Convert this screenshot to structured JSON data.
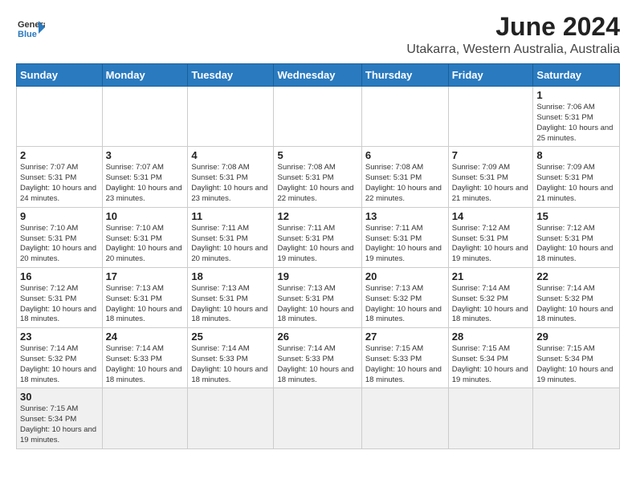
{
  "logo": {
    "text_general": "General",
    "text_blue": "Blue"
  },
  "title": "June 2024",
  "subtitle": "Utakarra, Western Australia, Australia",
  "days_of_week": [
    "Sunday",
    "Monday",
    "Tuesday",
    "Wednesday",
    "Thursday",
    "Friday",
    "Saturday"
  ],
  "weeks": [
    [
      {
        "day": "",
        "info": ""
      },
      {
        "day": "",
        "info": ""
      },
      {
        "day": "",
        "info": ""
      },
      {
        "day": "",
        "info": ""
      },
      {
        "day": "",
        "info": ""
      },
      {
        "day": "",
        "info": ""
      },
      {
        "day": "1",
        "info": "Sunrise: 7:06 AM\nSunset: 5:31 PM\nDaylight: 10 hours\nand 25 minutes."
      }
    ],
    [
      {
        "day": "2",
        "info": "Sunrise: 7:07 AM\nSunset: 5:31 PM\nDaylight: 10 hours\nand 24 minutes."
      },
      {
        "day": "3",
        "info": "Sunrise: 7:07 AM\nSunset: 5:31 PM\nDaylight: 10 hours\nand 23 minutes."
      },
      {
        "day": "4",
        "info": "Sunrise: 7:08 AM\nSunset: 5:31 PM\nDaylight: 10 hours\nand 23 minutes."
      },
      {
        "day": "5",
        "info": "Sunrise: 7:08 AM\nSunset: 5:31 PM\nDaylight: 10 hours\nand 22 minutes."
      },
      {
        "day": "6",
        "info": "Sunrise: 7:08 AM\nSunset: 5:31 PM\nDaylight: 10 hours\nand 22 minutes."
      },
      {
        "day": "7",
        "info": "Sunrise: 7:09 AM\nSunset: 5:31 PM\nDaylight: 10 hours\nand 21 minutes."
      },
      {
        "day": "8",
        "info": "Sunrise: 7:09 AM\nSunset: 5:31 PM\nDaylight: 10 hours\nand 21 minutes."
      }
    ],
    [
      {
        "day": "9",
        "info": "Sunrise: 7:10 AM\nSunset: 5:31 PM\nDaylight: 10 hours\nand 20 minutes."
      },
      {
        "day": "10",
        "info": "Sunrise: 7:10 AM\nSunset: 5:31 PM\nDaylight: 10 hours\nand 20 minutes."
      },
      {
        "day": "11",
        "info": "Sunrise: 7:11 AM\nSunset: 5:31 PM\nDaylight: 10 hours\nand 20 minutes."
      },
      {
        "day": "12",
        "info": "Sunrise: 7:11 AM\nSunset: 5:31 PM\nDaylight: 10 hours\nand 19 minutes."
      },
      {
        "day": "13",
        "info": "Sunrise: 7:11 AM\nSunset: 5:31 PM\nDaylight: 10 hours\nand 19 minutes."
      },
      {
        "day": "14",
        "info": "Sunrise: 7:12 AM\nSunset: 5:31 PM\nDaylight: 10 hours\nand 19 minutes."
      },
      {
        "day": "15",
        "info": "Sunrise: 7:12 AM\nSunset: 5:31 PM\nDaylight: 10 hours\nand 18 minutes."
      }
    ],
    [
      {
        "day": "16",
        "info": "Sunrise: 7:12 AM\nSunset: 5:31 PM\nDaylight: 10 hours\nand 18 minutes."
      },
      {
        "day": "17",
        "info": "Sunrise: 7:13 AM\nSunset: 5:31 PM\nDaylight: 10 hours\nand 18 minutes."
      },
      {
        "day": "18",
        "info": "Sunrise: 7:13 AM\nSunset: 5:31 PM\nDaylight: 10 hours\nand 18 minutes."
      },
      {
        "day": "19",
        "info": "Sunrise: 7:13 AM\nSunset: 5:31 PM\nDaylight: 10 hours\nand 18 minutes."
      },
      {
        "day": "20",
        "info": "Sunrise: 7:13 AM\nSunset: 5:32 PM\nDaylight: 10 hours\nand 18 minutes."
      },
      {
        "day": "21",
        "info": "Sunrise: 7:14 AM\nSunset: 5:32 PM\nDaylight: 10 hours\nand 18 minutes."
      },
      {
        "day": "22",
        "info": "Sunrise: 7:14 AM\nSunset: 5:32 PM\nDaylight: 10 hours\nand 18 minutes."
      }
    ],
    [
      {
        "day": "23",
        "info": "Sunrise: 7:14 AM\nSunset: 5:32 PM\nDaylight: 10 hours\nand 18 minutes."
      },
      {
        "day": "24",
        "info": "Sunrise: 7:14 AM\nSunset: 5:33 PM\nDaylight: 10 hours\nand 18 minutes."
      },
      {
        "day": "25",
        "info": "Sunrise: 7:14 AM\nSunset: 5:33 PM\nDaylight: 10 hours\nand 18 minutes."
      },
      {
        "day": "26",
        "info": "Sunrise: 7:14 AM\nSunset: 5:33 PM\nDaylight: 10 hours\nand 18 minutes."
      },
      {
        "day": "27",
        "info": "Sunrise: 7:15 AM\nSunset: 5:33 PM\nDaylight: 10 hours\nand 18 minutes."
      },
      {
        "day": "28",
        "info": "Sunrise: 7:15 AM\nSunset: 5:34 PM\nDaylight: 10 hours\nand 19 minutes."
      },
      {
        "day": "29",
        "info": "Sunrise: 7:15 AM\nSunset: 5:34 PM\nDaylight: 10 hours\nand 19 minutes."
      }
    ],
    [
      {
        "day": "30",
        "info": "Sunrise: 7:15 AM\nSunset: 5:34 PM\nDaylight: 10 hours\nand 19 minutes."
      },
      {
        "day": "",
        "info": ""
      },
      {
        "day": "",
        "info": ""
      },
      {
        "day": "",
        "info": ""
      },
      {
        "day": "",
        "info": ""
      },
      {
        "day": "",
        "info": ""
      },
      {
        "day": "",
        "info": ""
      }
    ]
  ]
}
